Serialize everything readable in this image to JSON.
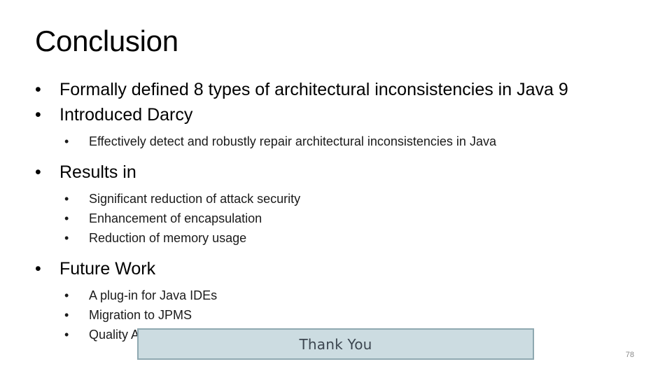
{
  "slide": {
    "title": "Conclusion",
    "page_number": "78",
    "bullet_glyph": "•",
    "colors": {
      "background": "#ffffff",
      "text": "#000000",
      "thankyou_fill": "#ccdce1",
      "thankyou_border": "#8fa9b1",
      "thankyou_text": "#3c4650",
      "page_number": "#8a8a8a"
    },
    "content": [
      {
        "level": 1,
        "text": "Formally defined 8 types of architectural inconsistencies in Java 9"
      },
      {
        "level": 1,
        "text": "Introduced Darcy"
      },
      {
        "level": 2,
        "text": "Effectively detect and robustly repair architectural inconsistencies in Java"
      },
      {
        "level": 1,
        "text": "Results in"
      },
      {
        "level": 2,
        "text": "Significant reduction of attack security"
      },
      {
        "level": 2,
        "text": "Enhancement of encapsulation"
      },
      {
        "level": 2,
        "text": "Reduction of memory usage"
      },
      {
        "level": 1,
        "text": "Future Work"
      },
      {
        "level": 2,
        "text": "A plug-in for Java IDEs"
      },
      {
        "level": 2,
        "text": "Migration to JPMS"
      },
      {
        "level": 2,
        "text": "Quality Assurance and Integration Testing"
      }
    ],
    "thank_you": {
      "label": "Thank You"
    }
  }
}
